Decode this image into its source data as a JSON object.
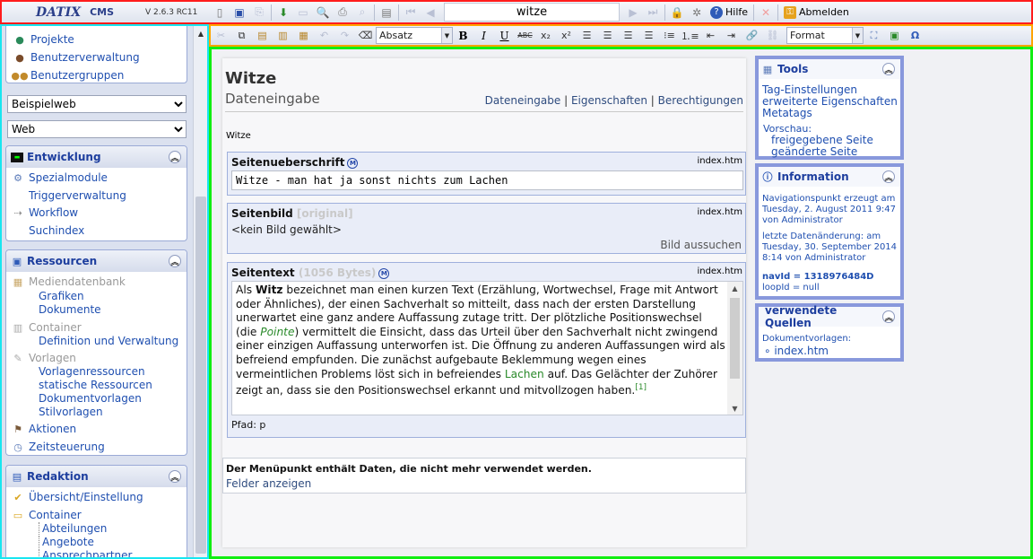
{
  "app": {
    "brand": "DATIX",
    "product": "CMS",
    "version": "V 2.6.3 RC11"
  },
  "topbar": {
    "current_page": "witze",
    "help_label": "Hilfe",
    "logout_label": "Abmelden"
  },
  "sidebar": {
    "top_items": [
      {
        "label": "Projekte",
        "icon": "globe-icon"
      },
      {
        "label": "Benutzerverwaltung",
        "icon": "user-icon"
      },
      {
        "label": "Benutzergruppen",
        "icon": "users-icon"
      }
    ],
    "site_select": {
      "value": "Beispielweb"
    },
    "area_select": {
      "value": "Web"
    },
    "entwicklung": {
      "title": "Entwicklung",
      "items": [
        {
          "label": "Spezialmodule"
        },
        {
          "label": "Triggerverwaltung"
        },
        {
          "label": "Workflow"
        },
        {
          "label": "Suchindex"
        }
      ]
    },
    "ressourcen": {
      "title": "Ressourcen",
      "mediendatenbank": "Mediendatenbank",
      "grafiken": "Grafiken",
      "dokumente": "Dokumente",
      "container": "Container",
      "container_def": "Definition und Verwaltung",
      "vorlagen": "Vorlagen",
      "vorlagenressourcen": "Vorlagenressourcen",
      "statische": "statische Ressourcen",
      "dokumentvorlagen": "Dokumentvorlagen",
      "stilvorlagen": "Stilvorlagen",
      "aktionen": "Aktionen",
      "zeitsteuerung": "Zeitsteuerung"
    },
    "redaktion": {
      "title": "Redaktion",
      "uebersicht": "Übersicht/Einstellung",
      "container": "Container",
      "abteilungen": "Abteilungen",
      "angebote": "Angebote",
      "ansprechpartner": "Ansprechpartner"
    }
  },
  "editor_toolbar": {
    "paragraph_format": "Absatz",
    "format": "Format"
  },
  "main": {
    "title": "Witze",
    "subtitle": "Dateneingabe",
    "views": {
      "dateneingabe": "Dateneingabe",
      "eigenschaften": "Eigenschaften",
      "berechtigungen": "Berechtigungen"
    },
    "crumb_name": "Witze",
    "fields": {
      "heading": {
        "label": "Seitenueberschrift",
        "file": "index.htm",
        "value": "Witze - man hat ja sonst nichts zum Lachen"
      },
      "image": {
        "label": "Seitenbild",
        "meta": "[original]",
        "file": "index.htm",
        "value": "<kein Bild gewählt>",
        "action": "Bild aussuchen"
      },
      "text": {
        "label": "Seitentext",
        "meta": "(1056 Bytes)",
        "file": "index.htm",
        "p1": "Als ",
        "p1b": "Witz",
        "p2": " bezeichnet man einen kurzen Text (Erzählung, Wortwechsel, Frage mit Antwort oder Ähnliches), der einen Sachverhalt so mitteilt, dass nach der ersten Darstellung unerwartet eine ganz andere Auffassung zutage tritt. Der plötzliche Positionswechsel (die ",
        "p3": "Pointe",
        "p4": ") vermittelt die Einsicht, dass das Urteil über den Sachverhalt nicht zwingend einer einzigen Auffassung unterworfen ist. Die Öffnung zu anderen Auffassungen wird als befreiend empfunden. Die zunächst aufgebaute Beklemmung wegen eines vermeintlichen Problems löst sich in befreiendes ",
        "p5": "Lachen",
        "p6": " auf. Das Gelächter der Zuhörer zeigt an, dass sie den Positionswechsel erkannt und mitvollzogen haben.",
        "ref": "[1]",
        "path": "Pfad: p"
      }
    },
    "notice": {
      "text": "Der Menüpunkt enthält Daten, die nicht mehr verwendet werden.",
      "link": "Felder anzeigen"
    }
  },
  "right": {
    "tools": {
      "title": "Tools",
      "l1": "Tag-Einstellungen",
      "l2": "erweiterte Eigenschaften",
      "l3": "Metatags",
      "preview": "Vorschau:",
      "p1": "freigegebene Seite",
      "p2": "geänderte Seite"
    },
    "info": {
      "title": "Information",
      "created": "Navigationspunkt erzeugt am Tuesday, 2. August 2011 9:47 von Administrator",
      "changed": "letzte Datenänderung: am Tuesday, 30. September 2014 8:14 von Administrator",
      "navid": "navId = 1318976484D",
      "loopid": "loopId = null"
    },
    "sources": {
      "title": "verwendete Quellen",
      "label": "Dokumentvorlagen:",
      "item": "index.htm"
    }
  }
}
